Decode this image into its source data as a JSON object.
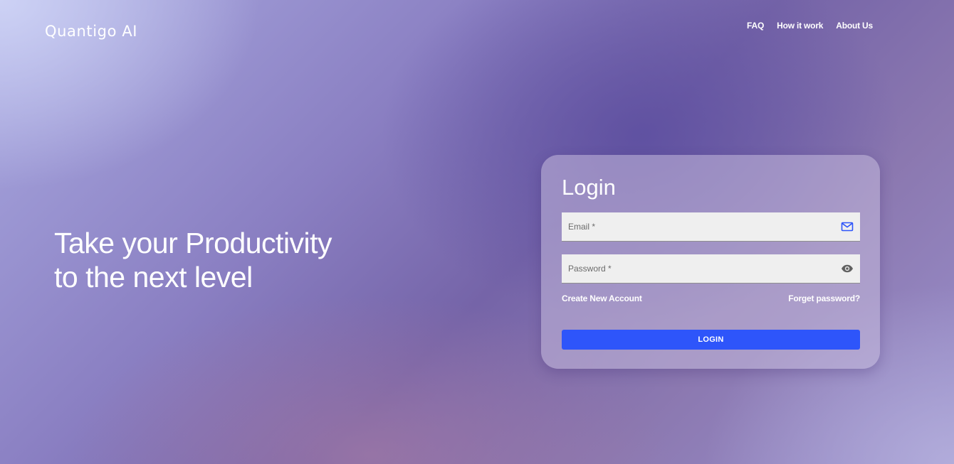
{
  "brand": {
    "name": "Quantigo AI"
  },
  "nav": {
    "items": [
      {
        "label": "FAQ"
      },
      {
        "label": "How it work"
      },
      {
        "label": "About Us"
      }
    ]
  },
  "hero": {
    "line1": "Take your Productivity",
    "line2": "to the next level"
  },
  "login": {
    "title": "Login",
    "email": {
      "placeholder": "Email *",
      "value": "",
      "icon": "mail-icon"
    },
    "password": {
      "placeholder": "Password *",
      "value": "",
      "icon": "eye-icon"
    },
    "create_account_label": "Create New Account",
    "forgot_password_label": "Forget password?",
    "submit_label": "LOGIN"
  },
  "colors": {
    "accent": "#2e55fa",
    "field_bg": "#efefef",
    "text_light": "#ffffff"
  }
}
